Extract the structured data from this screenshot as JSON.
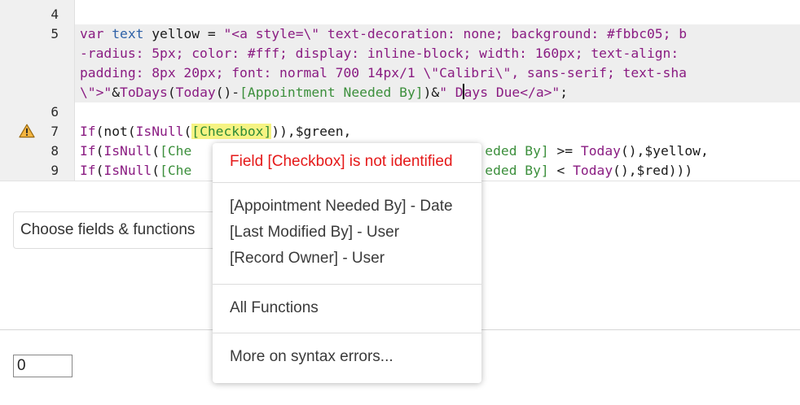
{
  "editor": {
    "line_numbers": [
      "4",
      "5",
      "6",
      "7",
      "8",
      "9"
    ],
    "line5": {
      "row1": {
        "kw": "var",
        "ty": "text",
        "plain": " yellow = ",
        "str": "\"<a style=\\\" text-decoration: none; background: #fbbc05; b"
      },
      "row2": "-radius: 5px; color: #fff; display: inline-block; width: 160px; text-align:",
      "row3": "padding: 8px 20px; font: normal 700 14px/1 \\\"Calibri\\\", sans-serif; text-sha",
      "row4": {
        "str1": "\\\">\"",
        "amp1": "&",
        "fn1": "ToDays",
        "p1": "(",
        "fn2": "Today",
        "p2": "()-",
        "field": "[Appointment Needed By]",
        "p3": ")",
        "amp2": "&",
        "str2a": "\" D",
        "str2b": "ays Due</a>\"",
        "end": ";"
      }
    },
    "line7": {
      "fn1": "If",
      "p1": "(not(",
      "fn2": "IsNull",
      "p2": "(",
      "field": "[Checkbox]",
      "p3": ")),$green,"
    },
    "line8": {
      "fn1": "If",
      "p1": "(",
      "fn2": "IsNull",
      "p2": "(",
      "field_a": "[Che",
      "field_b": "eded By]",
      "p3": " >= ",
      "fn3": "Today",
      "p4": "(),$yellow,"
    },
    "line9": {
      "fn1": "If",
      "p1": "(",
      "fn2": "IsNull",
      "p2": "(",
      "field_a": "[Che",
      "field_b": "eded By]",
      "p3": " < ",
      "fn3": "Today",
      "p4": "(),$red)))"
    },
    "warning_icon": "warning-triangle-icon"
  },
  "choose_button_label": "Choose fields & functions",
  "number_input_value": "0",
  "popup": {
    "error": "Field [Checkbox] is not identified",
    "fields": [
      "[Appointment Needed By] - Date",
      "[Last Modified By] - User",
      "[Record Owner] - User"
    ],
    "all_functions": "All Functions",
    "more_syntax": "More on syntax errors..."
  },
  "colors": {
    "keyword": "#8a1c82",
    "type": "#2e61a7",
    "field": "#3c8f3c",
    "field_highlight": "#f6f383",
    "error": "#e51919",
    "warning": "#f0a020"
  }
}
